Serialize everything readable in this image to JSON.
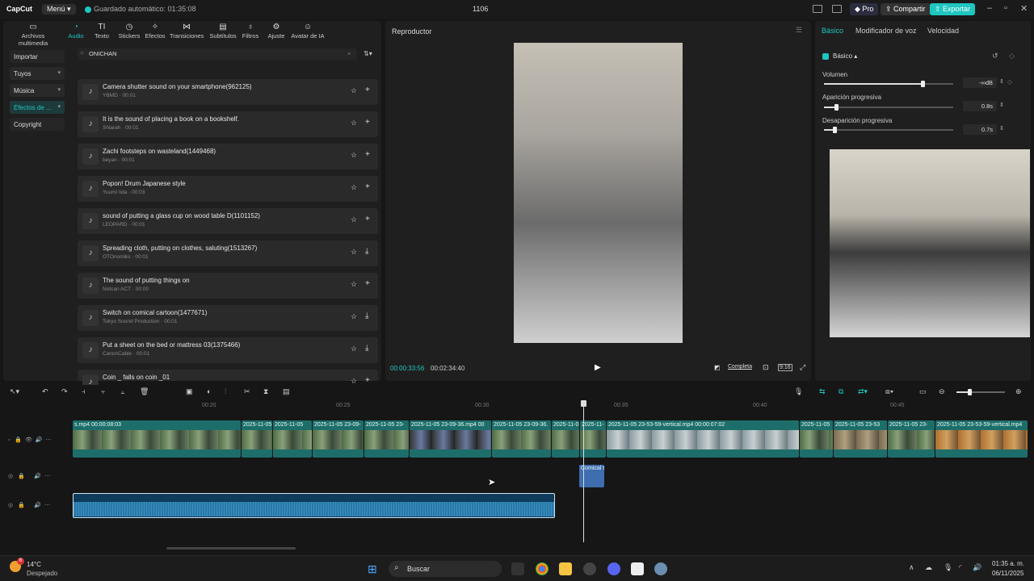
{
  "window": {
    "logo": "CapCut",
    "menu": "Menú",
    "autosave": "Guardado automático: 01:35:08",
    "project_title": "1106",
    "pro": "Pro",
    "share": "Compartir",
    "export": "Exportar"
  },
  "toolbar": {
    "tools": [
      {
        "label": "Archivos multimedia",
        "icon": "media-icon"
      },
      {
        "label": "Audio",
        "icon": "audio-icon"
      },
      {
        "label": "Texto",
        "icon": "text-icon"
      },
      {
        "label": "Stickers",
        "icon": "sticker-icon"
      },
      {
        "label": "Efectos",
        "icon": "effects-icon"
      },
      {
        "label": "Transiciones",
        "icon": "transitions-icon"
      },
      {
        "label": "Subtítulos",
        "icon": "subtitles-icon"
      },
      {
        "label": "Filtros",
        "icon": "filters-icon"
      },
      {
        "label": "Ajuste",
        "icon": "adjust-icon"
      },
      {
        "label": "Avatar de IA",
        "icon": "avatar-icon"
      }
    ],
    "active": "Audio"
  },
  "sidebar": {
    "items": [
      {
        "label": "Importar"
      },
      {
        "label": "Tuyos"
      },
      {
        "label": "Música"
      },
      {
        "label": "Efectos de ..."
      },
      {
        "label": "Copyright"
      }
    ],
    "active": "Efectos de ..."
  },
  "search": {
    "value": "ONICHAN"
  },
  "sounds": [
    {
      "title": "Camera shutter sound on your smartphone(962125)",
      "sub": "YBMD · 00:01",
      "action": "add"
    },
    {
      "title": "It is the sound of placing a book on a bookshelf.",
      "sub": "Shiarah · 00:01",
      "action": "add"
    },
    {
      "title": "Zachi footsteps on wasteland(1449468)",
      "sub": "beyan · 00:01",
      "action": "add"
    },
    {
      "title": "Popon! Drum Japanese style",
      "sub": "Yuumi Iida · 00:03",
      "action": "add"
    },
    {
      "title": "sound of putting a glass cup on wood table D(1101152)",
      "sub": "LEOPARD · 00:01",
      "action": "add"
    },
    {
      "title": "Spreading cloth, putting on clothes, saluting(1513267)",
      "sub": "OTOnomiks · 00:01",
      "action": "download"
    },
    {
      "title": "The sound of putting things on",
      "sub": "Notcan ACT · 00:00",
      "action": "add"
    },
    {
      "title": "Switch on comical cartoon(1477671)",
      "sub": "Tokyo Sound Production · 00:01",
      "action": "download"
    },
    {
      "title": "Put a sheet on the bed or mattress 03(1375466)",
      "sub": "CanonCable · 00:01",
      "action": "download"
    },
    {
      "title": "Coin _ falls on coin _01",
      "sub": "",
      "action": "add"
    }
  ],
  "player": {
    "title": "Reproductor",
    "current": "00:00:33:56",
    "duration": "00:02:34:40",
    "full": "Completa",
    "ratio": "9:16"
  },
  "properties": {
    "tabs": [
      "Básico",
      "Modificador de voz",
      "Velocidad"
    ],
    "section": "Básico",
    "params": [
      {
        "label": "Volumen",
        "value": "-∞dB",
        "level": 0.75
      },
      {
        "label": "Aparición progresiva",
        "value": "0.8s",
        "level": 0.08
      },
      {
        "label": "Desaparición progresiva",
        "value": "0.7s",
        "level": 0.07
      }
    ]
  },
  "timeline": {
    "ruler": [
      "00:20",
      "00:25",
      "00:30",
      "00:35",
      "00:40",
      "00:45"
    ],
    "video_clips": [
      "s.mp4  00:00:08:03",
      "2025-11-05",
      "2025-11-05",
      "2025-11-05 23-09-",
      "2025-11-05 23-",
      "2025-11-05 23-09-36.mp4  00",
      "2025-11-05 23-09-36.",
      "2025-11-0",
      "2025-11-",
      "2025-11-05 23-53-59-vertical.mp4  00:00:07:02",
      "2025-11-05",
      "2025-11-05 23-53",
      "2025-11-05 23-",
      "2025-11-05 23-53-59-vertical.mp4"
    ],
    "sfx_clip": "Comical t"
  },
  "taskbar": {
    "temp": "14°C",
    "condition": "Despejado",
    "search": "Buscar",
    "time": "01:35 a. m.",
    "date": "06/11/2025",
    "weather_badge": "6"
  },
  "colors": {
    "accent": "#1fc6c0",
    "clip": "#1d6e6a",
    "audio": "#0f3c5c"
  }
}
